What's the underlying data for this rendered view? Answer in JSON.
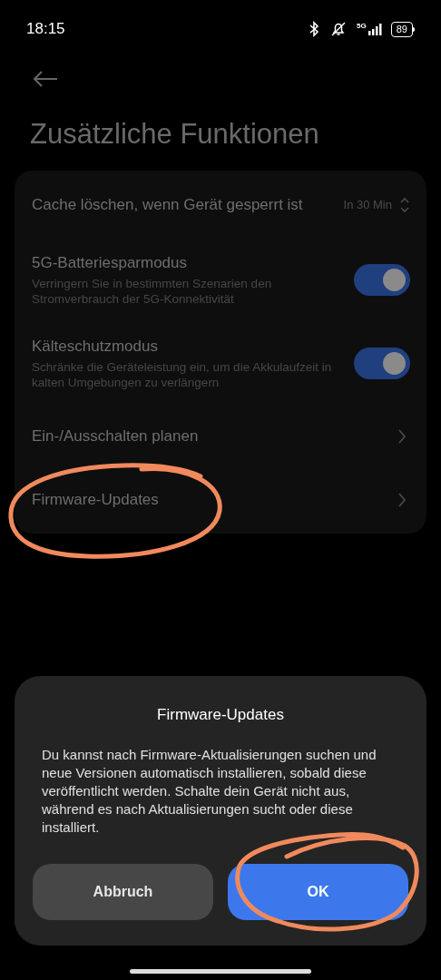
{
  "status_bar": {
    "time": "18:15",
    "network": "5G",
    "battery": "89"
  },
  "page": {
    "title": "Zusätzliche Funktionen"
  },
  "settings": [
    {
      "kind": "select",
      "title": "Cache löschen, wenn Gerät gesperrt ist",
      "value": "In 30 Min"
    },
    {
      "kind": "toggle",
      "title": "5G-Batteriesparmodus",
      "subtitle": "Verringern Sie in bestimmten Szenarien den Stromverbrauch der 5G-Konnektivität",
      "on": true
    },
    {
      "kind": "toggle",
      "title": "Kälteschutzmodus",
      "subtitle": "Schränke die Geräteleistung ein, um die Akkulaufzeit in kalten Umgebungen zu verlängern",
      "on": true
    },
    {
      "kind": "link",
      "title": "Ein-/Ausschalten planen"
    },
    {
      "kind": "link",
      "title": "Firmware-Updates"
    }
  ],
  "dialog": {
    "title": "Firmware-Updates",
    "message": "Du kannst nach Firmware-Aktualisierungen suchen und neue Versionen automatisch installieren, sobald diese veröffentlicht werden. Schalte dein Gerät nicht aus, während es nach Aktualisierungen sucht oder diese installiert.",
    "buttons": [
      {
        "kind": "secondary",
        "label": "Abbruch"
      },
      {
        "kind": "primary",
        "label": "OK"
      }
    ]
  }
}
